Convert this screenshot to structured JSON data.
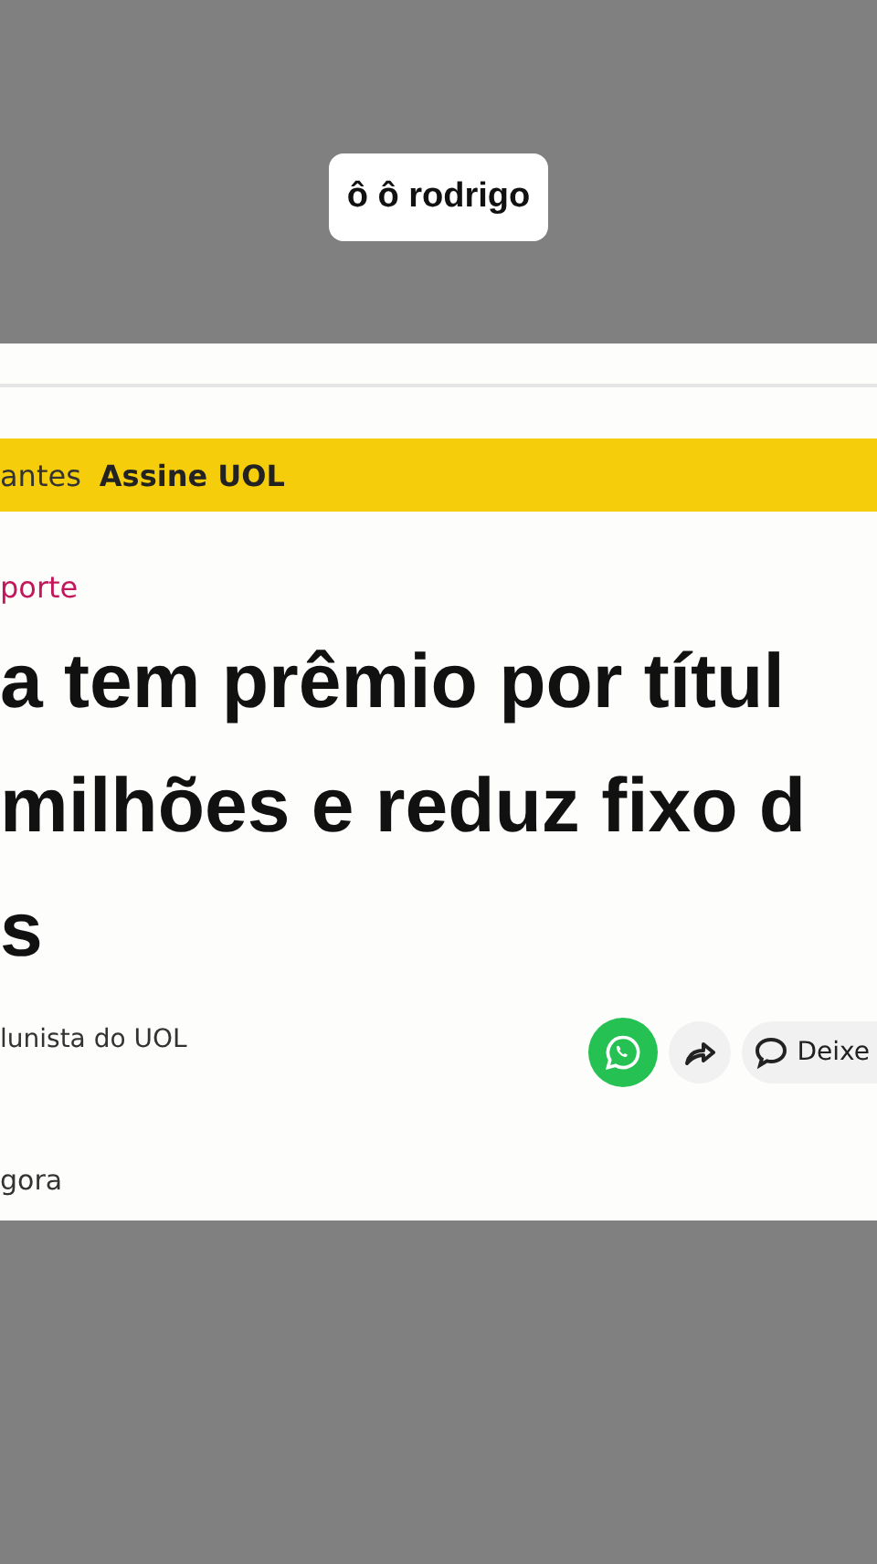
{
  "caption": "ô ô rodrigo",
  "nav": {
    "left_text": "antes",
    "subscribe_link": "Assine UOL"
  },
  "article": {
    "category": "porte",
    "headline_lines": [
      "a tem prêmio por títul",
      "milhões e reduz fixo d",
      "s"
    ],
    "byline": "lunista do UOL",
    "comment_button": "Deixe",
    "time": "gora"
  }
}
